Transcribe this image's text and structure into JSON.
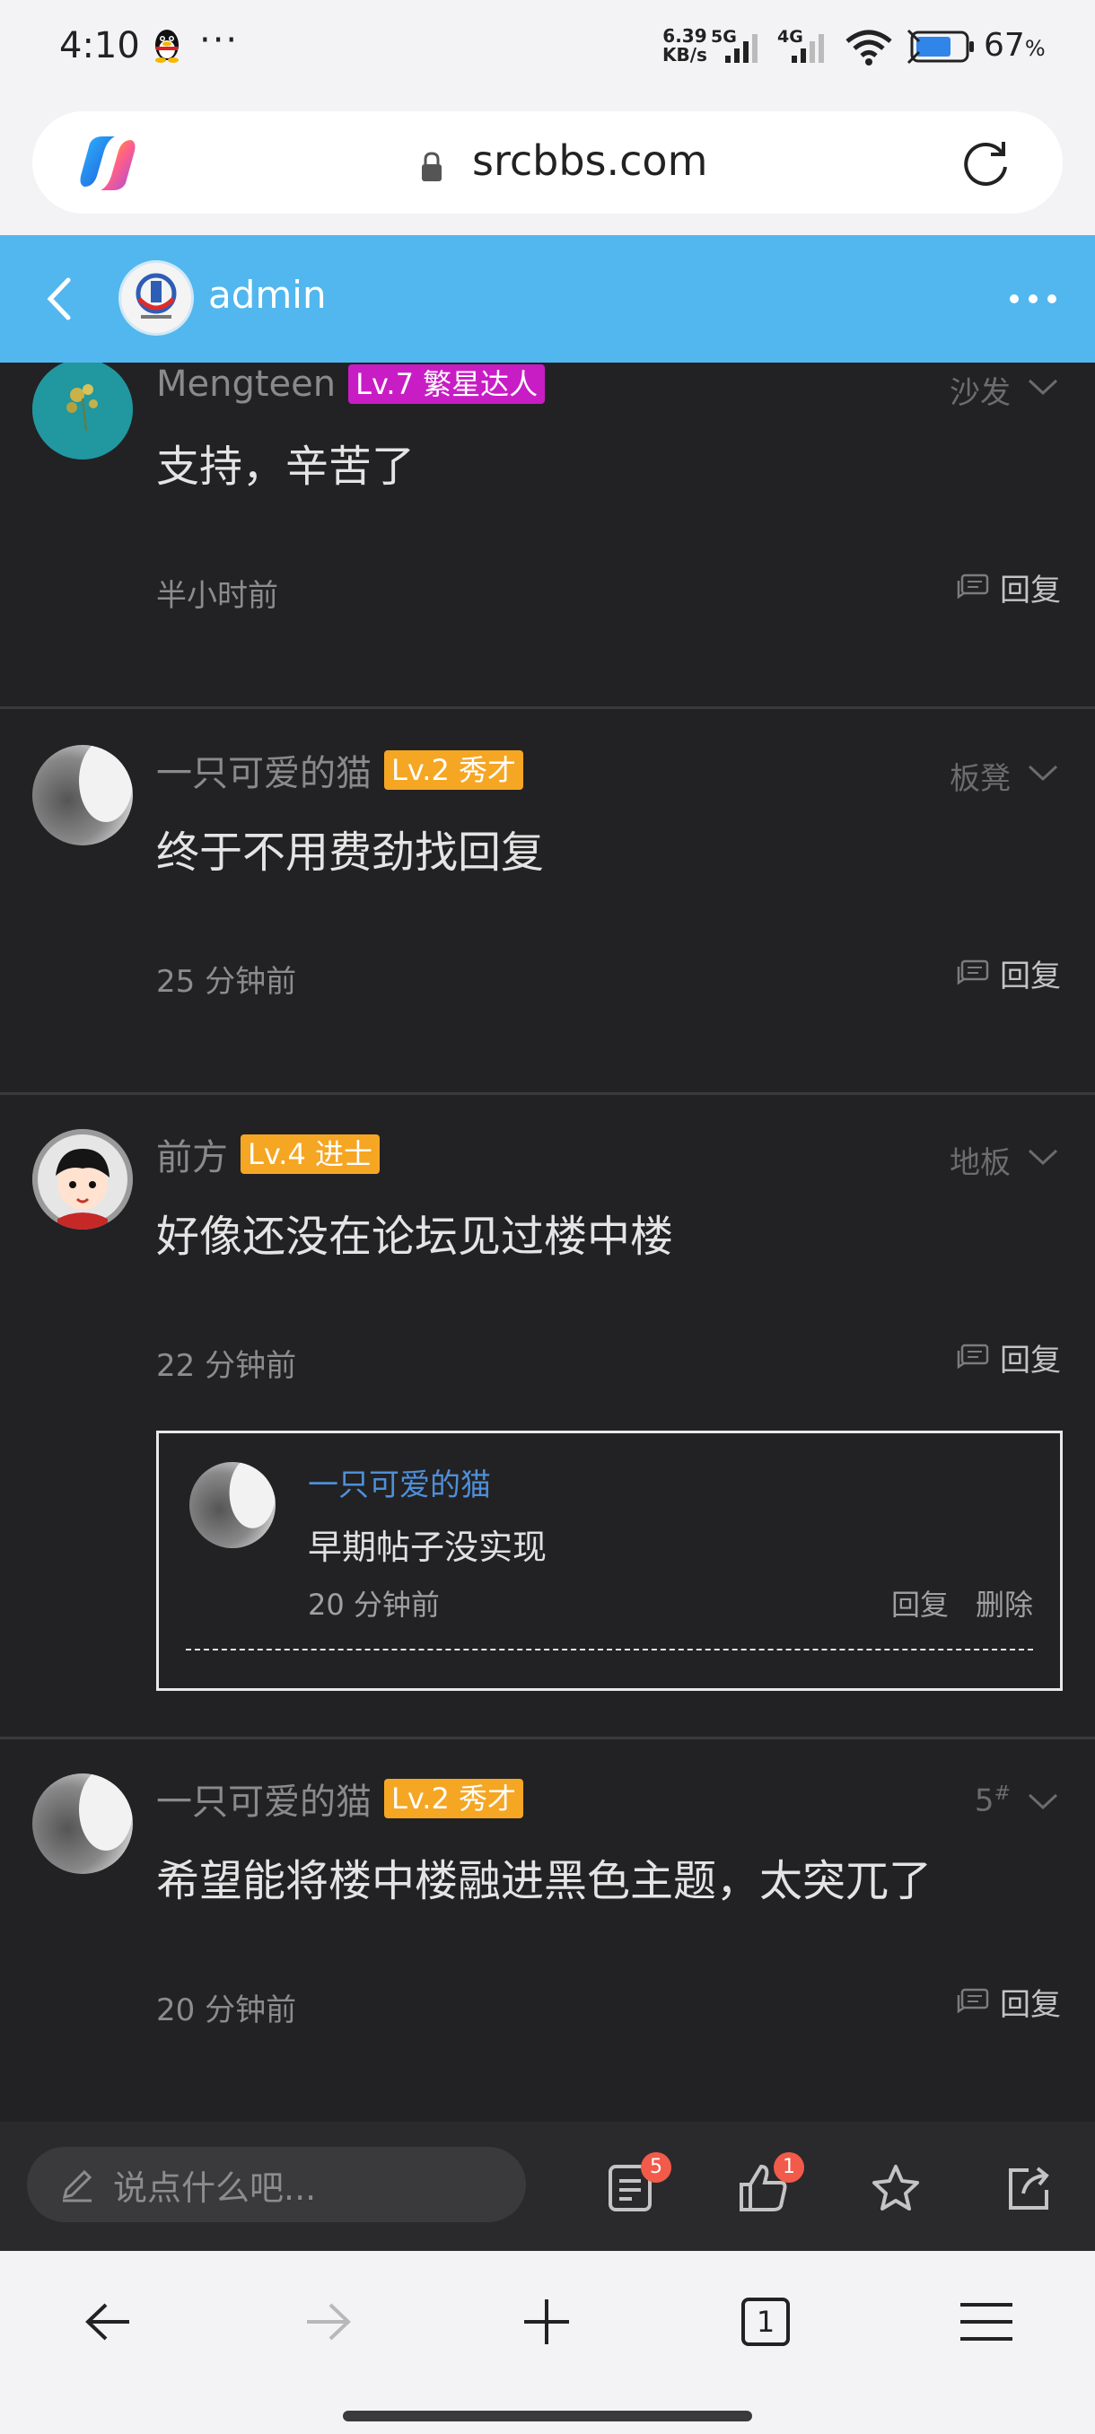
{
  "status_bar": {
    "time": "4:10",
    "more": "···",
    "net_speed_value": "6.39",
    "net_speed_unit": "KB/s",
    "signal1_label": "5G",
    "signal2_label": "4G",
    "battery_percent": "67",
    "battery_unit": "%"
  },
  "browser": {
    "url": "srcbbs.com"
  },
  "header": {
    "title": "admin"
  },
  "posts": [
    {
      "username": "Mengteen",
      "level": "Lv.7 繁星达人",
      "level_color": "#c81dc4",
      "floor": "沙发",
      "content": "支持，辛苦了",
      "time": "半小时前",
      "reply_label": "回复"
    },
    {
      "username": "一只可爱的猫",
      "level": "Lv.2 秀才",
      "level_color": "#f5a623",
      "floor": "板凳",
      "content": "终于不用费劲找回复",
      "time": "25 分钟前",
      "reply_label": "回复"
    },
    {
      "username": "前方",
      "level": "Lv.4 进士",
      "level_color": "#f5a623",
      "floor": "地板",
      "content": "好像还没在论坛见过楼中楼",
      "time": "22 分钟前",
      "reply_label": "回复",
      "subreply": {
        "username": "一只可爱的猫",
        "content": "早期帖子没实现",
        "time": "20 分钟前",
        "reply_label": "回复",
        "delete_label": "删除"
      }
    },
    {
      "username": "一只可爱的猫",
      "level": "Lv.2 秀才",
      "level_color": "#f5a623",
      "floor": "5",
      "floor_sup": "#",
      "content": "希望能将楼中楼融进黑色主题，太突兀了",
      "time": "20 分钟前",
      "reply_label": "回复"
    }
  ],
  "action_bar": {
    "input_placeholder": "说点什么吧...",
    "comments_badge": "5",
    "likes_badge": "1"
  },
  "nav_bar": {
    "tab_count": "1"
  },
  "colors": {
    "header_bg": "#52b7ee",
    "page_bg": "#222224",
    "badge_red": "#f25a4a",
    "subreply_user": "#4f8fd8"
  },
  "icons": [
    "qq-icon",
    "wifi-icon",
    "battery-icon",
    "copilot-icon",
    "lock-icon",
    "reload-icon",
    "back-icon",
    "more-icon",
    "chevron-down-icon",
    "comment-icon",
    "pencil-icon",
    "document-icon",
    "thumbs-up-icon",
    "star-icon",
    "share-icon",
    "arrow-left-icon",
    "arrow-right-icon",
    "plus-icon",
    "tabs-icon",
    "menu-icon"
  ]
}
